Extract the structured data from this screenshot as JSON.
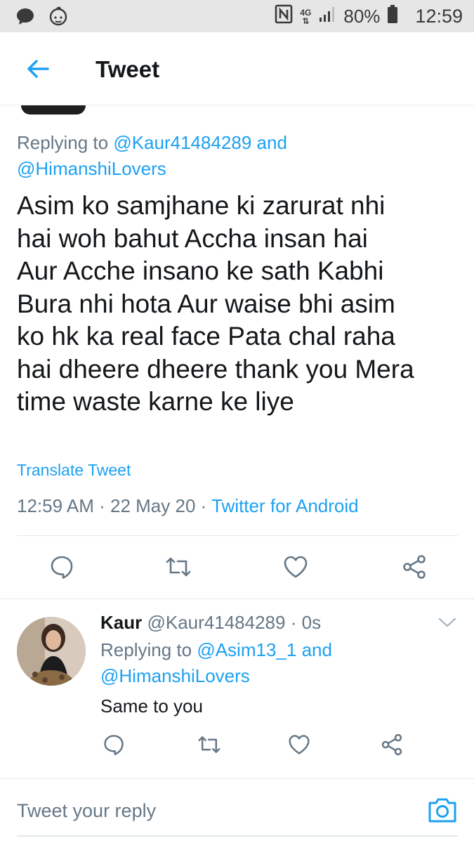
{
  "status_bar": {
    "battery": "80%",
    "time": "12:59",
    "network": "4G",
    "icons": [
      "message-icon",
      "baby-icon",
      "nfc-icon",
      "network-icon",
      "signal-icon",
      "battery-icon"
    ]
  },
  "header": {
    "title": "Tweet",
    "back_icon": "arrow-left-icon"
  },
  "tweet": {
    "replying_prefix": "Replying to",
    "replying_user1": "@Kaur41484289",
    "replying_and": "and",
    "replying_user2": "@HimanshiLovers",
    "text_lines": [
      "Asim ko samjhane ki zarurat nhi",
      "hai woh bahut Accha insan hai",
      "Aur Acche insano ke sath Kabhi",
      "Bura nhi hota Aur waise bhi asim",
      "ko hk ka real face Pata chal raha",
      "hai dheere dheere thank you Mera",
      "time waste karne ke liye"
    ],
    "translate": "Translate Tweet",
    "time": "12:59 AM",
    "separator": "·",
    "date": "22 May 20",
    "source": "Twitter for Android"
  },
  "reply": {
    "name": "Kaur",
    "handle": "@Kaur41484289",
    "time": "0s",
    "separator": "·",
    "replying_prefix": "Replying to",
    "replying_user1": "@Asim13_1",
    "replying_and": "and",
    "replying_user2": "@HimanshiLovers",
    "text": "Same to you"
  },
  "compose": {
    "placeholder": "Tweet your reply",
    "camera_icon": "camera-icon"
  },
  "colors": {
    "accent": "#1da1f2",
    "secondary_text": "#657786",
    "primary_text": "#14171a",
    "status_bar_bg": "#e6e6e6"
  }
}
